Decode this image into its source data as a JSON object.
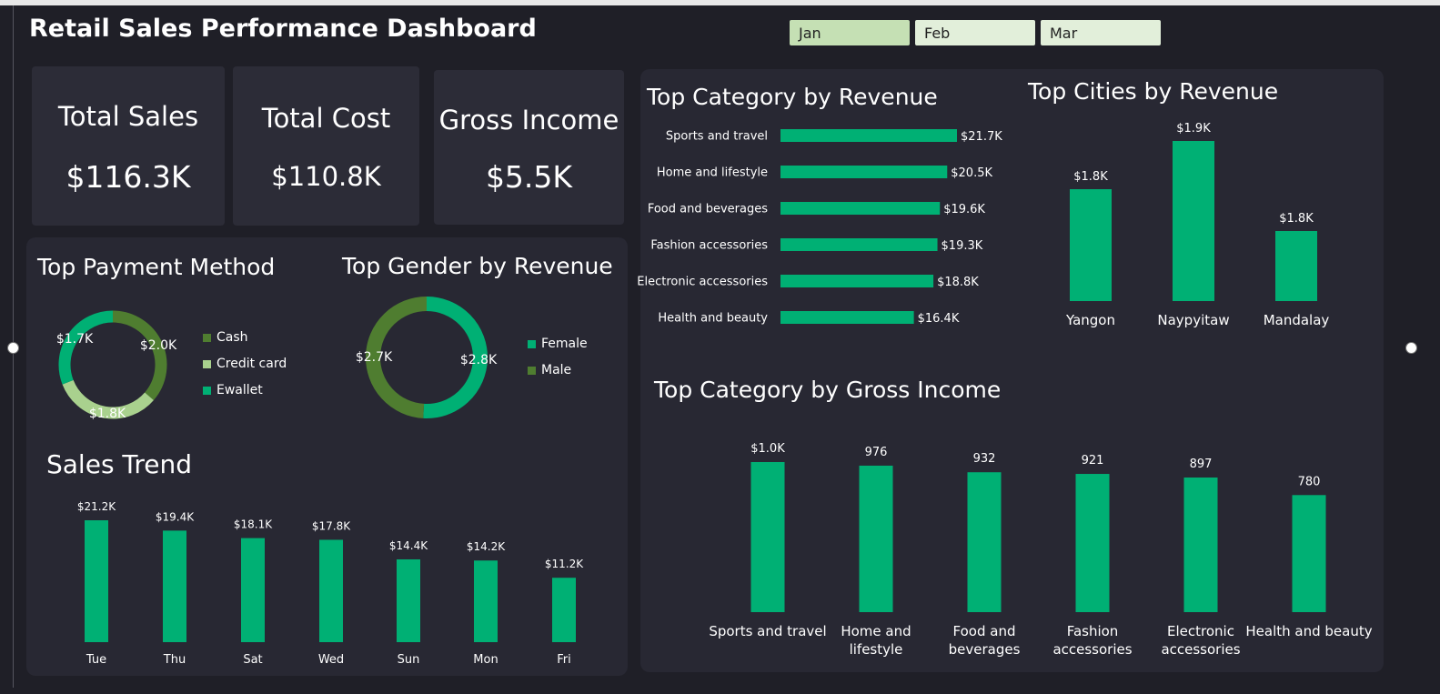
{
  "title": "Retail Sales Performance Dashboard",
  "months": [
    "Jan",
    "Feb",
    "Mar"
  ],
  "colors": {
    "accent": "#00b074",
    "dark_green": "#4f7d30",
    "light_green": "#a9d18e",
    "slicer_active": "#c5e0b4",
    "slicer": "#e2efda"
  },
  "kpis": [
    {
      "label": "Total Sales",
      "value": "$116.3K"
    },
    {
      "label": "Total Cost",
      "value": "$110.8K"
    },
    {
      "label": "Gross Income",
      "value": "$5.5K"
    }
  ],
  "payment": {
    "title": "Top Payment Method"
  },
  "gender": {
    "title": "Top Gender by Revenue"
  },
  "trend": {
    "title": "Sales Trend"
  },
  "category_revenue": {
    "title": "Top Category by Revenue"
  },
  "cities": {
    "title": "Top Cities by Revenue"
  },
  "category_income": {
    "title": "Top Category by Gross Income"
  },
  "chart_data": [
    {
      "type": "pie",
      "title": "Top Payment Method",
      "categories": [
        "Cash",
        "Credit card",
        "Ewallet"
      ],
      "values": [
        2.0,
        1.8,
        1.7
      ],
      "labels": [
        "$2.0K",
        "$1.8K",
        "$1.7K"
      ],
      "legend": "right"
    },
    {
      "type": "pie",
      "title": "Top Gender by Revenue",
      "categories": [
        "Female",
        "Male"
      ],
      "values": [
        2.8,
        2.7
      ],
      "labels": [
        "$2.8K",
        "$2.7K"
      ],
      "legend": "right"
    },
    {
      "type": "bar",
      "title": "Sales Trend",
      "categories": [
        "Tue",
        "Thu",
        "Sat",
        "Wed",
        "Sun",
        "Mon",
        "Fri"
      ],
      "values": [
        21.2,
        19.4,
        18.1,
        17.8,
        14.4,
        14.2,
        11.2
      ],
      "labels": [
        "$21.2K",
        "$19.4K",
        "$18.1K",
        "$17.8K",
        "$14.4K",
        "$14.2K",
        "$11.2K"
      ]
    },
    {
      "type": "bar",
      "orientation": "horizontal",
      "title": "Top Category by Revenue",
      "categories": [
        "Sports and travel",
        "Home and lifestyle",
        "Food and beverages",
        "Fashion accessories",
        "Electronic accessories",
        "Health and beauty"
      ],
      "values": [
        21.7,
        20.5,
        19.6,
        19.3,
        18.8,
        16.4
      ],
      "labels": [
        "$21.7K",
        "$20.5K",
        "$19.6K",
        "$19.3K",
        "$18.8K",
        "$16.4K"
      ]
    },
    {
      "type": "bar",
      "title": "Top Cities by Revenue",
      "categories": [
        "Yangon",
        "Naypyitaw",
        "Mandalay"
      ],
      "values": [
        1.8,
        1.9,
        1.8
      ],
      "labels": [
        "$1.8K",
        "$1.9K",
        "$1.8K"
      ]
    },
    {
      "type": "bar",
      "title": "Top Category by Gross Income",
      "categories": [
        [
          "Sports and travel"
        ],
        [
          "Home and",
          "lifestyle"
        ],
        [
          "Food and",
          "beverages"
        ],
        [
          "Fashion",
          "accessories"
        ],
        [
          "Electronic",
          "accessories"
        ],
        [
          "Health and beauty"
        ]
      ],
      "values": [
        1000,
        976,
        932,
        921,
        897,
        780
      ],
      "labels": [
        "$1.0K",
        "976",
        "932",
        "921",
        "897",
        "780"
      ]
    }
  ]
}
